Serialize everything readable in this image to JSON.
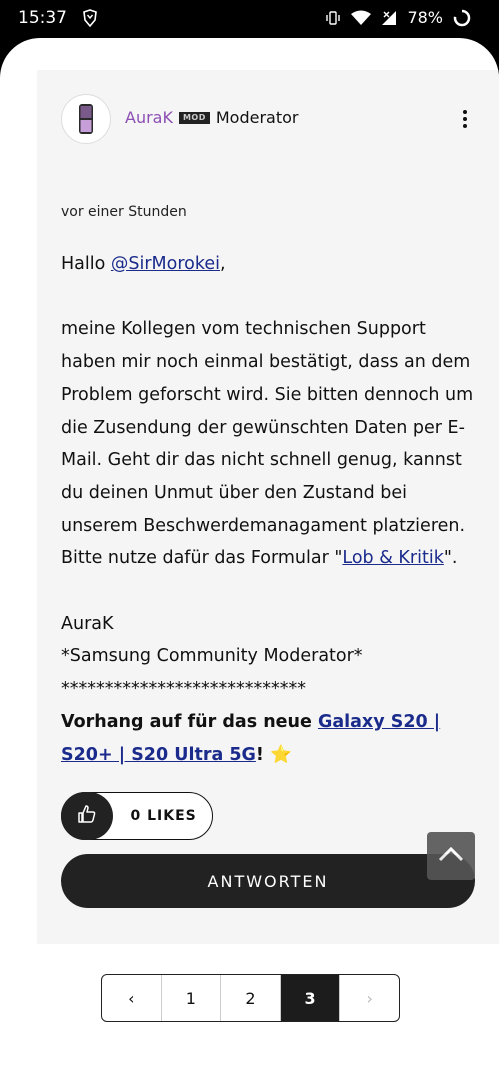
{
  "status_bar": {
    "time": "15:37",
    "battery": "78%"
  },
  "post": {
    "author": "AuraK",
    "badge": "MOD",
    "role": "Moderator",
    "timestamp": "vor einer Stunden",
    "greeting_prefix": "Hallo ",
    "mention": "@SirMorokei",
    "greeting_suffix": ",",
    "para_before_link": "meine Kollegen vom technischen Support haben mir noch einmal bestätigt, dass an dem Problem geforscht wird. Sie bitten dennoch um die Zusendung der gewünschten Daten per E-Mail. Geht dir das nicht schnell genug, kannst du deinen Unmut über den Zustand bei unserem Beschwerdemanagament platzieren. Bitte nutze dafür das Formular \"",
    "link_text": "Lob & Kritik",
    "para_after_link": "\".",
    "signature_name": "AuraK",
    "signature_title": "*Samsung Community Moderator*",
    "signature_line": "****************************",
    "promo_prefix": "Vorhang auf für das neue ",
    "promo_link": "Galaxy S20 | S20+ | S20 Ultra 5G",
    "promo_suffix": "! ",
    "promo_emoji": "⭐",
    "likes_label": "0 LIKES",
    "reply_label": "ANTWORTEN"
  },
  "pagination": {
    "prev": "‹",
    "pages": [
      "1",
      "2",
      "3"
    ],
    "current": "3",
    "next": "›"
  },
  "colors": {
    "author": "#8d4fb5",
    "link": "#1a2b8c",
    "button": "#222222"
  },
  "icons": [
    "brave-shield-icon",
    "vibrate-icon",
    "wifi-icon",
    "signal-icon",
    "battery-icon",
    "kebab-menu-icon",
    "thumbs-up-icon",
    "chevron-up-icon"
  ]
}
